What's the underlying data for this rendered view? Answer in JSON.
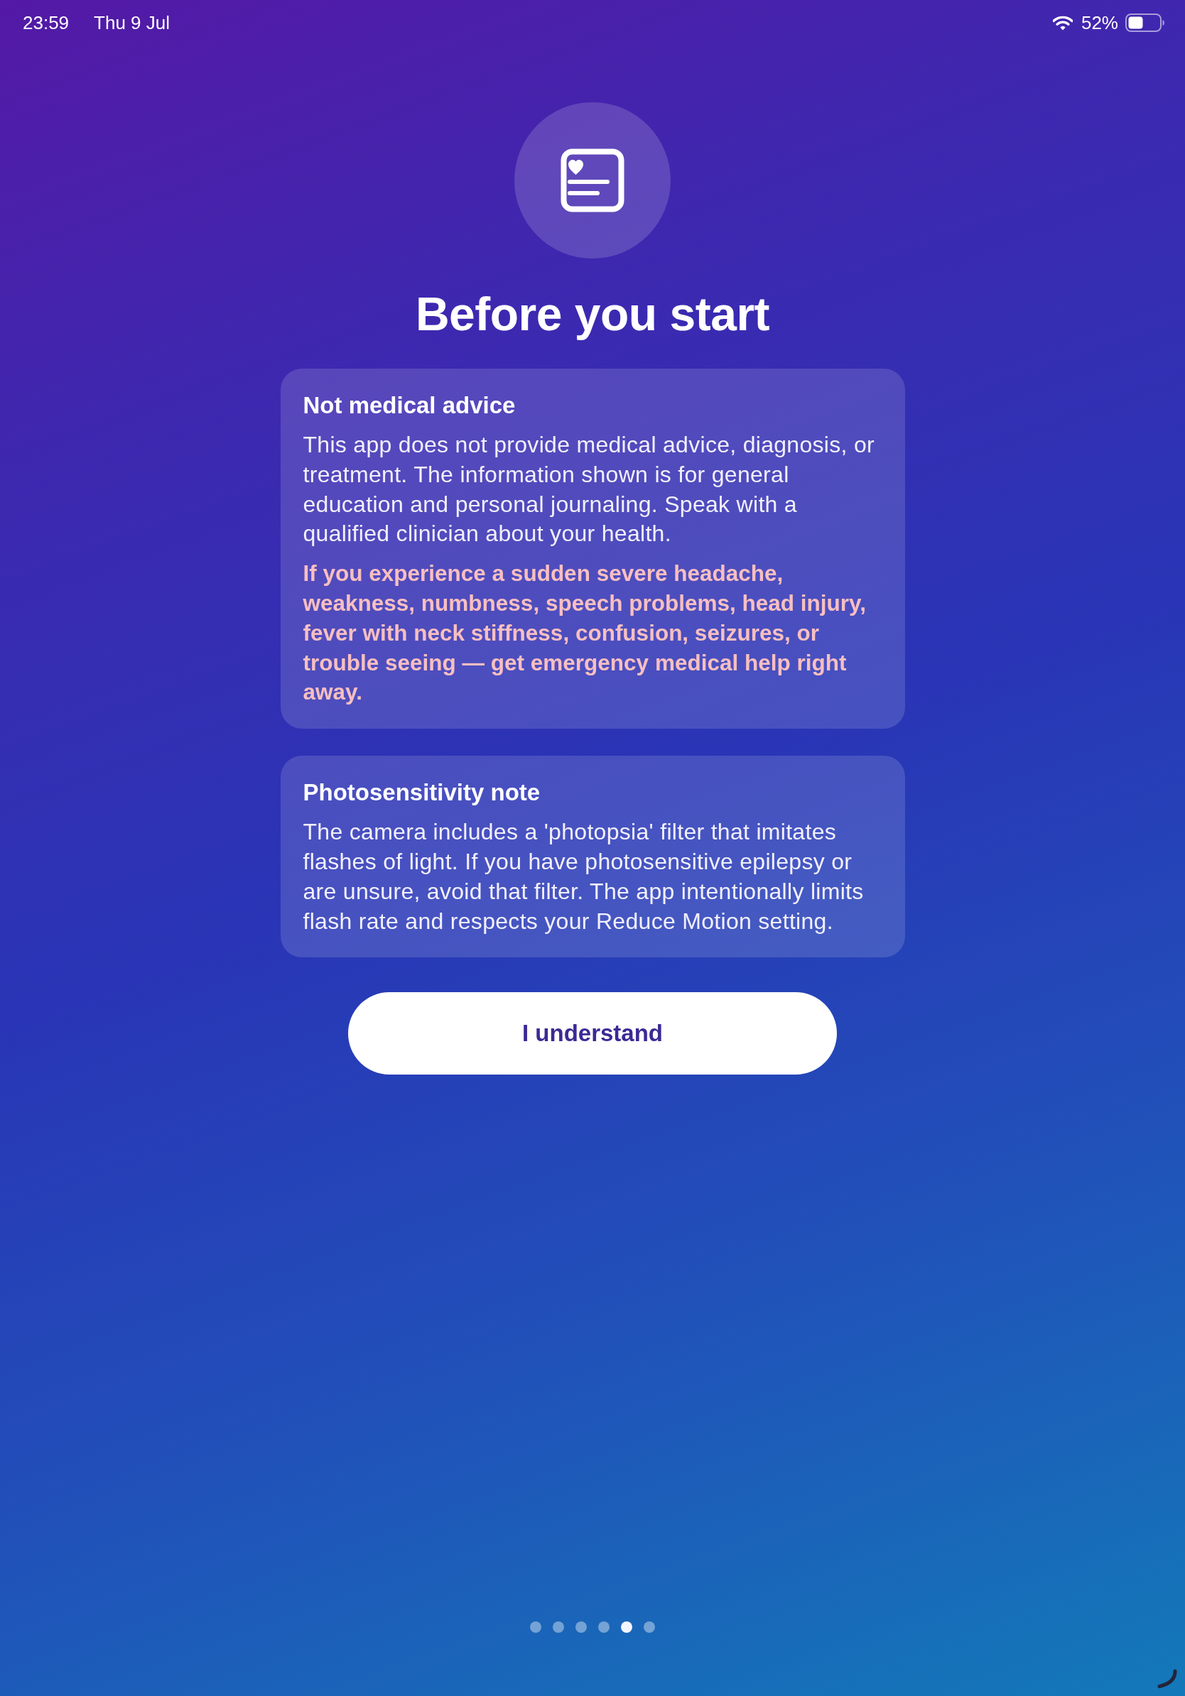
{
  "status_bar": {
    "time": "23:59",
    "date": "Thu 9 Jul",
    "battery": "52%"
  },
  "header": {
    "title": "Before you start"
  },
  "cards": [
    {
      "title": "Not medical advice",
      "paragraphs": [
        {
          "kind": "body",
          "text": "This app does not provide medical advice, diagnosis, or treatment. The information shown is for general education and personal journaling. Speak with a qualified clinician about your health."
        },
        {
          "kind": "warning",
          "text": "If you experience a sudden severe headache, weakness, numbness, speech problems, head injury, fever with neck stiffness, confusion, seizures, or trouble seeing — get emergency medical help right away."
        }
      ]
    },
    {
      "title": "Photosensitivity note",
      "paragraphs": [
        {
          "kind": "body",
          "text": "The camera includes a 'photopsia' filter that imitates flashes of light. If you have photosensitive epilepsy or are unsure, avoid that filter. The app intentionally limits flash rate and respects your Reduce Motion setting."
        }
      ]
    }
  ],
  "button": {
    "label": "I understand"
  },
  "page_dots": [
    {
      "selected": false
    },
    {
      "selected": false
    },
    {
      "selected": false
    },
    {
      "selected": false
    },
    {
      "selected": true
    },
    {
      "selected": false
    }
  ]
}
